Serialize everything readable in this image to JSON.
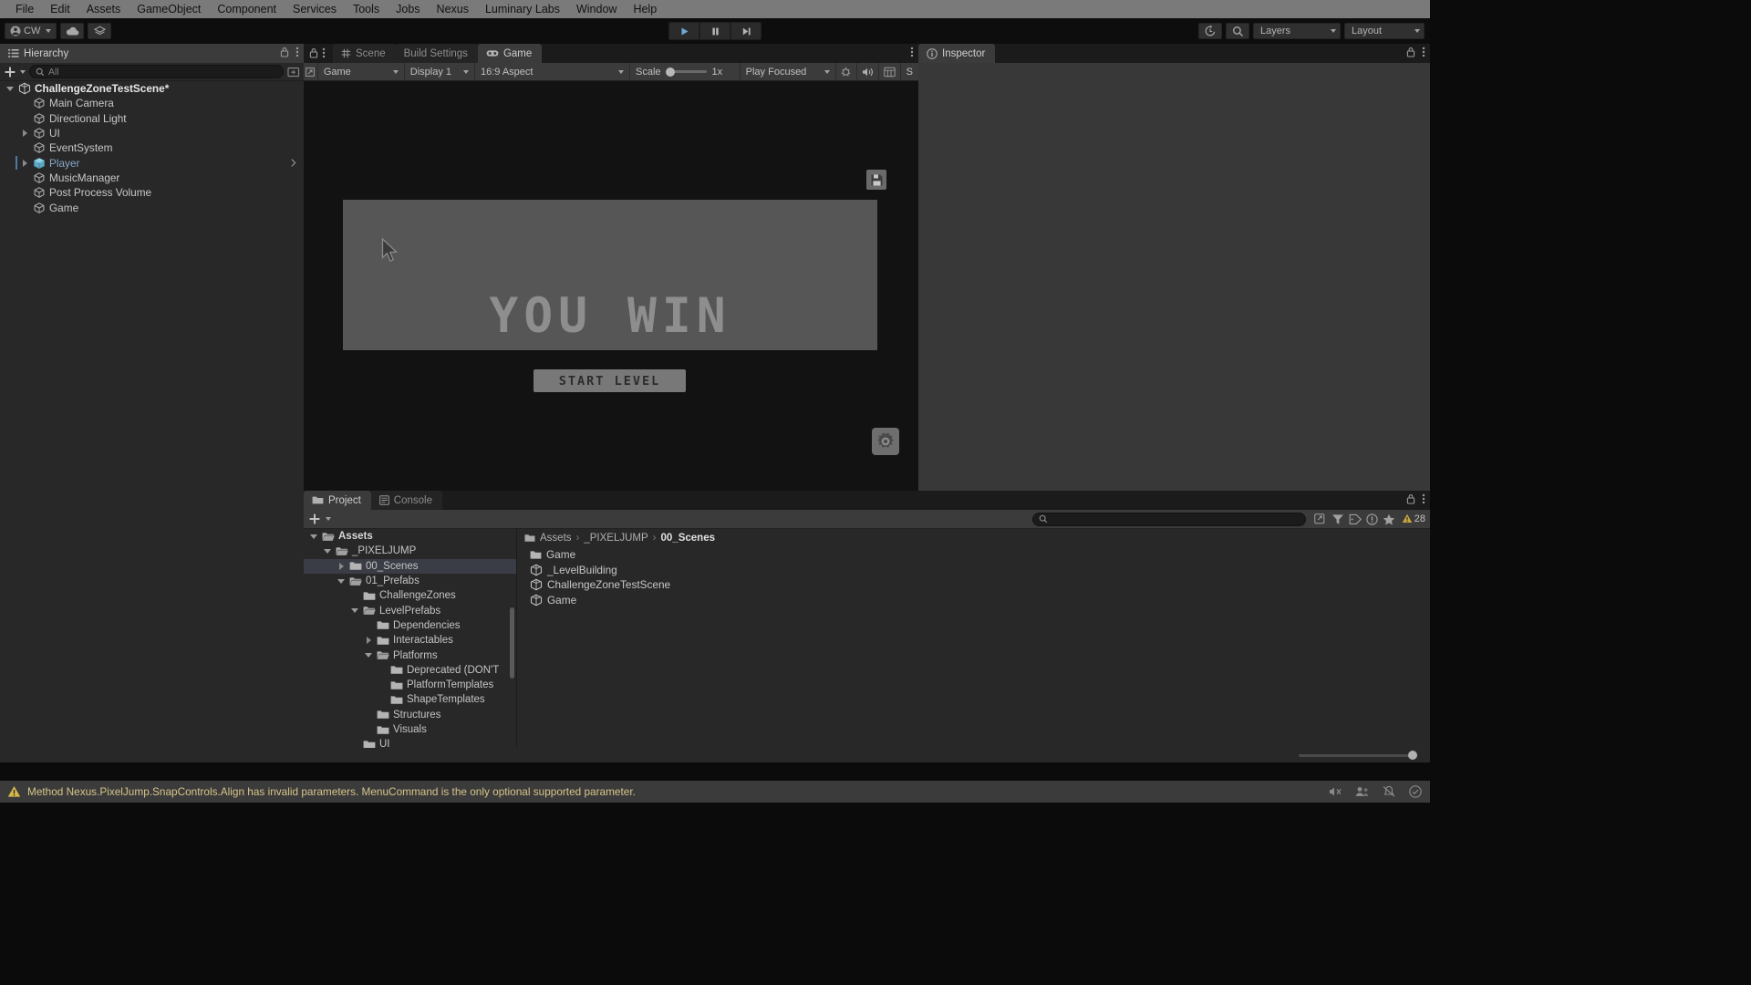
{
  "menubar": {
    "items": [
      {
        "label": "File"
      },
      {
        "label": "Edit"
      },
      {
        "label": "Assets"
      },
      {
        "label": "GameObject"
      },
      {
        "label": "Component"
      },
      {
        "label": "Services"
      },
      {
        "label": "Tools"
      },
      {
        "label": "Jobs"
      },
      {
        "label": "Nexus"
      },
      {
        "label": "Luminary Labs"
      },
      {
        "label": "Window"
      },
      {
        "label": "Help"
      }
    ]
  },
  "toolbar": {
    "account_label": "CW",
    "cloud_icon": "cloud-icon",
    "services_icon": "layers-icon",
    "play_icon": "play-icon",
    "pause_icon": "pause-icon",
    "step_icon": "step-forward-icon",
    "history_icon": "history-icon",
    "search_icon": "search-icon",
    "layers_label": "Layers",
    "layout_label": "Layout"
  },
  "hierarchy": {
    "tab_label": "Hierarchy",
    "tab_icon": "hierarchy-icon",
    "add_icon": "plus-icon",
    "search_placeholder": "All",
    "search_icon": "search-icon",
    "lock_icon": "lock-icon",
    "menu_icon": "kebab-menu-icon",
    "visibility_icon": "eye-toggle-icon",
    "items": [
      {
        "label": "ChallengeZoneTestScene*",
        "indent": 0,
        "arrow": "down",
        "icon": "unity-scene-icon",
        "kind": "scene",
        "selected": false
      },
      {
        "label": "Main Camera",
        "indent": 1,
        "arrow": "none",
        "icon": "gameobject-icon",
        "kind": "object",
        "selected": false
      },
      {
        "label": "Directional Light",
        "indent": 1,
        "arrow": "none",
        "icon": "gameobject-icon",
        "kind": "object",
        "selected": false
      },
      {
        "label": "UI",
        "indent": 1,
        "arrow": "right",
        "icon": "gameobject-icon",
        "kind": "object",
        "selected": false
      },
      {
        "label": "EventSystem",
        "indent": 1,
        "arrow": "none",
        "icon": "gameobject-icon",
        "kind": "object",
        "selected": false
      },
      {
        "label": "Player",
        "indent": 1,
        "arrow": "right",
        "icon": "prefab-icon",
        "kind": "prefab",
        "selected": true
      },
      {
        "label": "MusicManager",
        "indent": 1,
        "arrow": "none",
        "icon": "gameobject-icon",
        "kind": "object",
        "selected": false
      },
      {
        "label": "Post Process Volume",
        "indent": 1,
        "arrow": "none",
        "icon": "gameobject-icon",
        "kind": "object",
        "selected": false
      },
      {
        "label": "Game",
        "indent": 1,
        "arrow": "none",
        "icon": "gameobject-icon",
        "kind": "object",
        "selected": false
      }
    ]
  },
  "gameview": {
    "tabs": [
      {
        "label": "Scene",
        "icon": "grid-icon",
        "active": false
      },
      {
        "label": "Build Settings",
        "icon": "none",
        "active": false
      },
      {
        "label": "Game",
        "icon": "gamepad-icon",
        "active": true
      }
    ],
    "menu_icon": "kebab-menu-icon",
    "controls": {
      "target_label": "Game",
      "display_label": "Display 1",
      "aspect_label": "16:9 Aspect",
      "scale_label": "Scale",
      "scale_value": "1x",
      "play_mode_label": "Play Focused",
      "mute_icon": "mute-audio-icon",
      "stats_icon": "stats-icon",
      "gizmos_icon": "gizmos-icon",
      "bug_icon": "bug-icon",
      "overflow_label": "S"
    },
    "content": {
      "win_text": "YOU WIN",
      "start_button_label": "START LEVEL",
      "save_hud_icon": "save-icon",
      "settings_hud_icon": "gear-icon",
      "panel_color": "#565656",
      "win_text_color": "#8e8e8e",
      "button_color": "#787878"
    }
  },
  "inspector": {
    "tab_label": "Inspector",
    "tab_icon": "info-icon",
    "lock_icon": "lock-icon",
    "menu_icon": "kebab-menu-icon"
  },
  "project": {
    "tabs": [
      {
        "label": "Project",
        "icon": "folder-icon",
        "active": true
      },
      {
        "label": "Console",
        "icon": "console-icon",
        "active": false
      }
    ],
    "add_icon": "plus-icon",
    "favorite_icon": "star-icon",
    "lock_icon": "lock-icon",
    "menu_icon": "kebab-menu-icon",
    "search_placeholder": "",
    "search_icon": "search-icon",
    "filter_icons": [
      "save-search-icon",
      "type-filter-icon",
      "label-filter-icon",
      "warning-filter-icon",
      "favorite-filter-icon"
    ],
    "error_count": "28",
    "tree": [
      {
        "label": "Assets",
        "indent": 0,
        "arrow": "down",
        "open": true,
        "bold": true,
        "selected": false
      },
      {
        "label": "_PIXELJUMP",
        "indent": 1,
        "arrow": "down",
        "open": true,
        "bold": false,
        "selected": false
      },
      {
        "label": "00_Scenes",
        "indent": 2,
        "arrow": "right",
        "open": false,
        "bold": false,
        "selected": true
      },
      {
        "label": "01_Prefabs",
        "indent": 2,
        "arrow": "down",
        "open": true,
        "bold": false,
        "selected": false
      },
      {
        "label": "ChallengeZones",
        "indent": 3,
        "arrow": "none",
        "open": false,
        "bold": false,
        "selected": false
      },
      {
        "label": "LevelPrefabs",
        "indent": 3,
        "arrow": "down",
        "open": true,
        "bold": false,
        "selected": false
      },
      {
        "label": "Dependencies",
        "indent": 4,
        "arrow": "none",
        "open": false,
        "bold": false,
        "selected": false
      },
      {
        "label": "Interactables",
        "indent": 4,
        "arrow": "right",
        "open": false,
        "bold": false,
        "selected": false
      },
      {
        "label": "Platforms",
        "indent": 4,
        "arrow": "down",
        "open": true,
        "bold": false,
        "selected": false
      },
      {
        "label": "Deprecated (DON'T",
        "indent": 5,
        "arrow": "none",
        "open": false,
        "bold": false,
        "selected": false
      },
      {
        "label": "PlatformTemplates",
        "indent": 5,
        "arrow": "none",
        "open": false,
        "bold": false,
        "selected": false
      },
      {
        "label": "ShapeTemplates",
        "indent": 5,
        "arrow": "none",
        "open": false,
        "bold": false,
        "selected": false
      },
      {
        "label": "Structures",
        "indent": 4,
        "arrow": "none",
        "open": false,
        "bold": false,
        "selected": false
      },
      {
        "label": "Visuals",
        "indent": 4,
        "arrow": "none",
        "open": false,
        "bold": false,
        "selected": false
      },
      {
        "label": "UI",
        "indent": 3,
        "arrow": "none",
        "open": false,
        "bold": false,
        "selected": false
      }
    ],
    "breadcrumb": [
      "Assets",
      "_PIXELJUMP",
      "00_Scenes"
    ],
    "assets": [
      {
        "label": "Game",
        "icon": "folder-icon"
      },
      {
        "label": "_LevelBuilding",
        "icon": "unity-scene-icon"
      },
      {
        "label": "ChallengeZoneTestScene",
        "icon": "unity-scene-icon"
      },
      {
        "label": "Game",
        "icon": "unity-scene-icon"
      }
    ]
  },
  "statusbar": {
    "warning_icon": "warning-icon",
    "message": "Method Nexus.PixelJump.SnapControls.Align has invalid parameters. MenuCommand is the only optional supported parameter.",
    "message_color": "#d6c58a",
    "right_icons": [
      "mute-icon",
      "collab-icon",
      "no-notification-icon",
      "cloud-status-icon"
    ]
  }
}
